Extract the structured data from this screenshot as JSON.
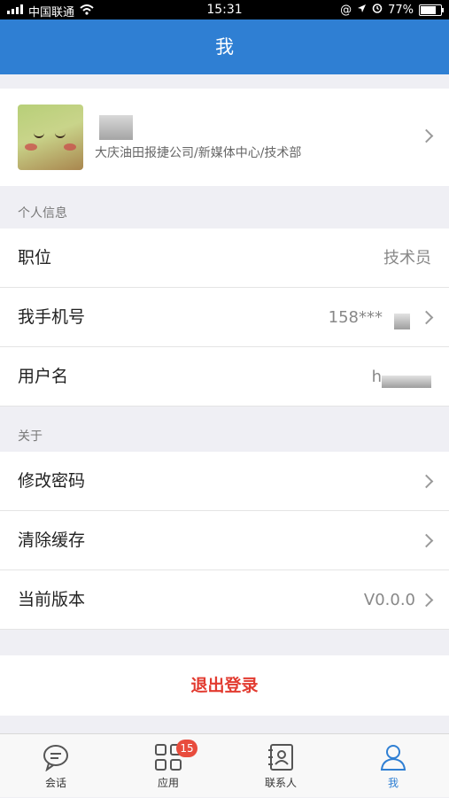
{
  "status_bar": {
    "carrier": "中国联通",
    "time": "15:31",
    "battery": "77%",
    "battery_level": 0.77
  },
  "nav": {
    "title": "我"
  },
  "profile": {
    "organization": "大庆油田报捷公司/新媒体中心/技术部"
  },
  "sections": {
    "personal_info": "个人信息",
    "about": "关于"
  },
  "rows": {
    "position": {
      "label": "职位",
      "value": "技术员"
    },
    "phone": {
      "label": "我手机号",
      "value": "158***"
    },
    "username": {
      "label": "用户名",
      "value": "h"
    },
    "change_password": {
      "label": "修改密码"
    },
    "clear_cache": {
      "label": "清除缓存"
    },
    "version": {
      "label": "当前版本",
      "value": "V0.0.0"
    }
  },
  "logout": {
    "label": "退出登录"
  },
  "tabs": [
    {
      "label": "会话",
      "icon": "chat-icon"
    },
    {
      "label": "应用",
      "icon": "apps-grid-icon",
      "badge": "15"
    },
    {
      "label": "联系人",
      "icon": "contacts-icon"
    },
    {
      "label": "我",
      "icon": "person-icon",
      "active": true
    }
  ],
  "colors": {
    "nav_blue": "#2f7fd3",
    "logout_red": "#e23b30",
    "badge_red": "#e84c3d"
  }
}
